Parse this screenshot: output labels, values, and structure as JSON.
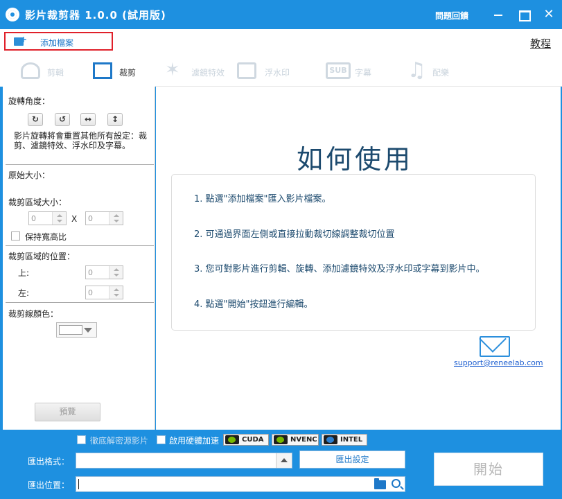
{
  "window": {
    "title": "影片裁剪器 1.0.0 (試用版)",
    "help_label": "問題回饋",
    "close_glyph": "✕"
  },
  "toolbar": {
    "add_file_label": "添加檔案",
    "tutorial_label": "教程"
  },
  "tabs": [
    {
      "label": "剪輯",
      "icon": "edit-icon",
      "active": false
    },
    {
      "label": "裁剪",
      "icon": "crop-icon",
      "active": true
    },
    {
      "label": "濾鏡特效",
      "icon": "filter-icon",
      "active": false
    },
    {
      "label": "浮水印",
      "icon": "watermark-icon",
      "active": false
    },
    {
      "label": "字幕",
      "icon": "subtitle-icon",
      "active": false,
      "icon_text": "SUB"
    },
    {
      "label": "配樂",
      "icon": "music-icon",
      "active": false
    }
  ],
  "left_panel": {
    "rotation_title": "旋轉角度：",
    "rotate_buttons": [
      {
        "glyph": "↻",
        "icon": "rotate-clockwise-icon"
      },
      {
        "glyph": "↺",
        "icon": "rotate-counterclockwise-icon"
      },
      {
        "glyph": "↔",
        "icon": "flip-horizontal-icon"
      },
      {
        "glyph": "↕",
        "icon": "flip-vertical-icon"
      }
    ],
    "rotation_note": "影片旋轉將會重置其他所有設定：裁剪、濾鏡特效、浮水印及字幕。",
    "original_size_label": "原始大小：",
    "crop_size_label": "裁剪區域大小：",
    "width_value": "0",
    "height_value": "0",
    "x_label": "X",
    "keep_ratio_label": "保持寬高比",
    "crop_position_label": "裁剪區域的位置：",
    "top_label": "上:",
    "top_value": "0",
    "left_label": "左:",
    "left_value": "0",
    "crop_line_color_label": "裁剪線顏色：",
    "crop_line_color": "#ffffff",
    "preview_label": "預覽"
  },
  "howto": {
    "title": "如何使用",
    "steps": [
      "1. 點選\"添加檔案\"匯入影片檔案。",
      "2. 可通過界面左側或直接拉動裁切線調整裁切位置",
      "3. 您可對影片進行剪輯、旋轉、添加濾鏡特效及浮水印或字幕到影片中。",
      "4. 點選\"開始\"按鈕進行編輯。"
    ],
    "support_email": "support@reneelab.com"
  },
  "bottom": {
    "merge_label": "徹底解密源影片",
    "hw_accel_label": "啟用硬體加速",
    "chips": [
      "CUDA",
      "NVENC",
      "INTEL"
    ],
    "format_label": "匯出格式：",
    "format_value": "",
    "export_settings_label": "匯出設定",
    "path_label": "匯出位置：",
    "path_value": "",
    "start_label": "開始"
  },
  "colors": {
    "brand_blue": "#1e90e0",
    "accent_blue": "#1e78c8",
    "highlight_red": "#e0202a",
    "howto_text": "#1c4a6e"
  }
}
